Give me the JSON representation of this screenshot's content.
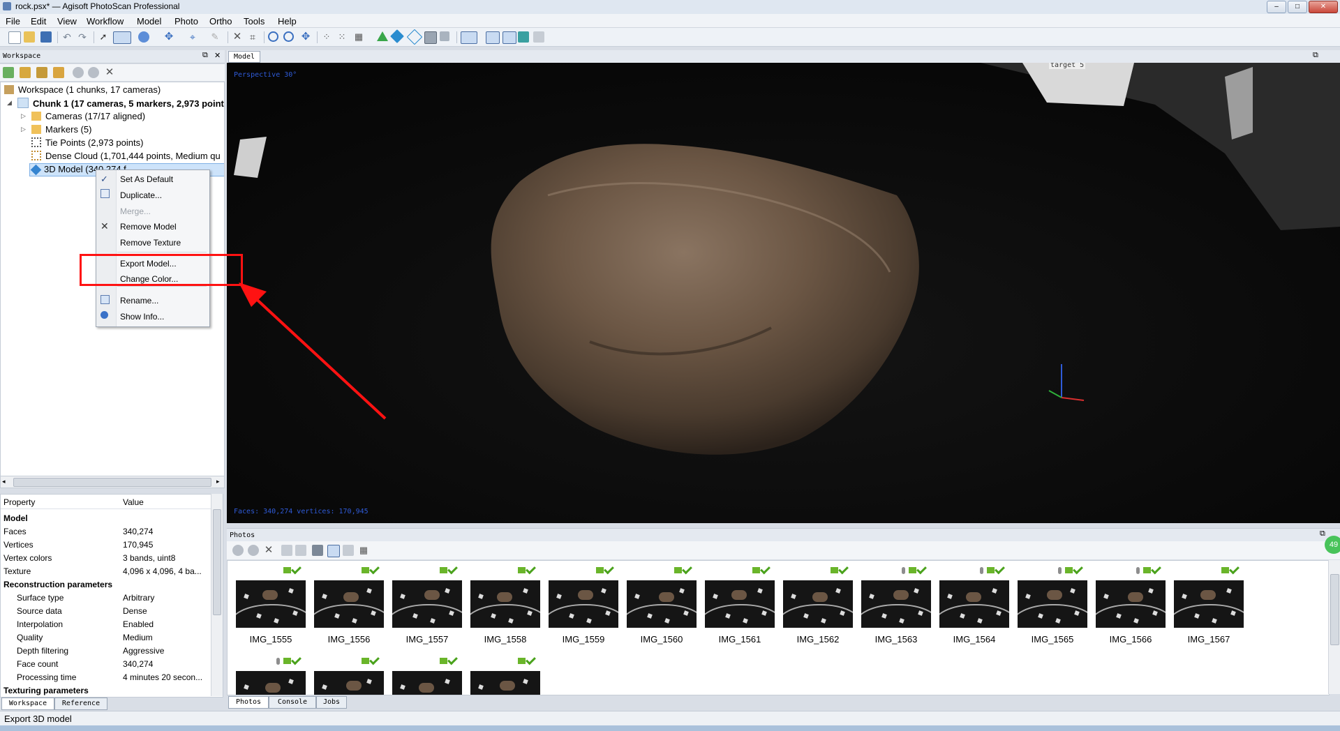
{
  "window": {
    "title": "rock.psx* — Agisoft PhotoScan Professional",
    "buttons": [
      "–",
      "□",
      "✕"
    ]
  },
  "menu": [
    "File",
    "Edit",
    "View",
    "Workflow",
    "Model",
    "Photo",
    "Ortho",
    "Tools",
    "Help"
  ],
  "workspace": {
    "pane_title": "Workspace",
    "tree": {
      "root": "Workspace (1 chunks, 17 cameras)",
      "chunk": "Chunk 1 (17 cameras, 5 markers, 2,973 points",
      "cameras": "Cameras (17/17 aligned)",
      "markers": "Markers (5)",
      "tie_points": "Tie Points (2,973 points)",
      "dense_cloud": "Dense Cloud (1,701,444 points, Medium qu",
      "model": "3D Model (340,274 f..."
    }
  },
  "context_menu": {
    "set_default": "Set As Default",
    "duplicate": "Duplicate...",
    "merge": "Merge...",
    "remove_model": "Remove Model",
    "remove_texture": "Remove Texture",
    "export_model": "Export Model...",
    "change_color": "Change Color...",
    "rename": "Rename...",
    "show_info": "Show Info..."
  },
  "properties": {
    "col_property": "Property",
    "col_value": "Value",
    "rows": [
      {
        "k": "Model",
        "v": "",
        "section": true
      },
      {
        "k": "Faces",
        "v": "340,274"
      },
      {
        "k": "Vertices",
        "v": "170,945"
      },
      {
        "k": "Vertex colors",
        "v": "3 bands, uint8"
      },
      {
        "k": "Texture",
        "v": "4,096 x 4,096, 4 ba..."
      },
      {
        "k": "Reconstruction parameters",
        "v": "",
        "section": true
      },
      {
        "k": "Surface type",
        "v": "Arbitrary",
        "indent": true
      },
      {
        "k": "Source data",
        "v": "Dense",
        "indent": true
      },
      {
        "k": "Interpolation",
        "v": "Enabled",
        "indent": true
      },
      {
        "k": "Quality",
        "v": "Medium",
        "indent": true
      },
      {
        "k": "Depth filtering",
        "v": "Aggressive",
        "indent": true
      },
      {
        "k": "Face count",
        "v": "340,274",
        "indent": true
      },
      {
        "k": "Processing time",
        "v": "4 minutes 20 secon...",
        "indent": true
      },
      {
        "k": "Texturing parameters",
        "v": "",
        "section": true
      }
    ]
  },
  "left_tabs": [
    "Workspace",
    "Reference"
  ],
  "model_view": {
    "tab": "Model",
    "projection": "Perspective 30°",
    "stats": "Faces: 340,274 vertices: 170,945",
    "target_label": "target 5"
  },
  "photos": {
    "pane_title": "Photos",
    "items": [
      {
        "name": "IMG_1555",
        "pin": false
      },
      {
        "name": "IMG_1556",
        "pin": false
      },
      {
        "name": "IMG_1557",
        "pin": false
      },
      {
        "name": "IMG_1558",
        "pin": false
      },
      {
        "name": "IMG_1559",
        "pin": false
      },
      {
        "name": "IMG_1560",
        "pin": false
      },
      {
        "name": "IMG_1561",
        "pin": false
      },
      {
        "name": "IMG_1562",
        "pin": false
      },
      {
        "name": "IMG_1563",
        "pin": true
      },
      {
        "name": "IMG_1564",
        "pin": true
      },
      {
        "name": "IMG_1565",
        "pin": true
      },
      {
        "name": "IMG_1566",
        "pin": true
      },
      {
        "name": "IMG_1567",
        "pin": false
      },
      {
        "name": "",
        "pin": true
      },
      {
        "name": "",
        "pin": false
      },
      {
        "name": "",
        "pin": false
      },
      {
        "name": "",
        "pin": false
      }
    ]
  },
  "bottom_tabs": [
    "Photos",
    "Console",
    "Jobs"
  ],
  "status": {
    "message": "Export 3D model",
    "badge": "49"
  },
  "colors": {
    "highlight": "#ff1212",
    "accent": "#2f5bd8",
    "ok_green": "#4aa21c"
  }
}
